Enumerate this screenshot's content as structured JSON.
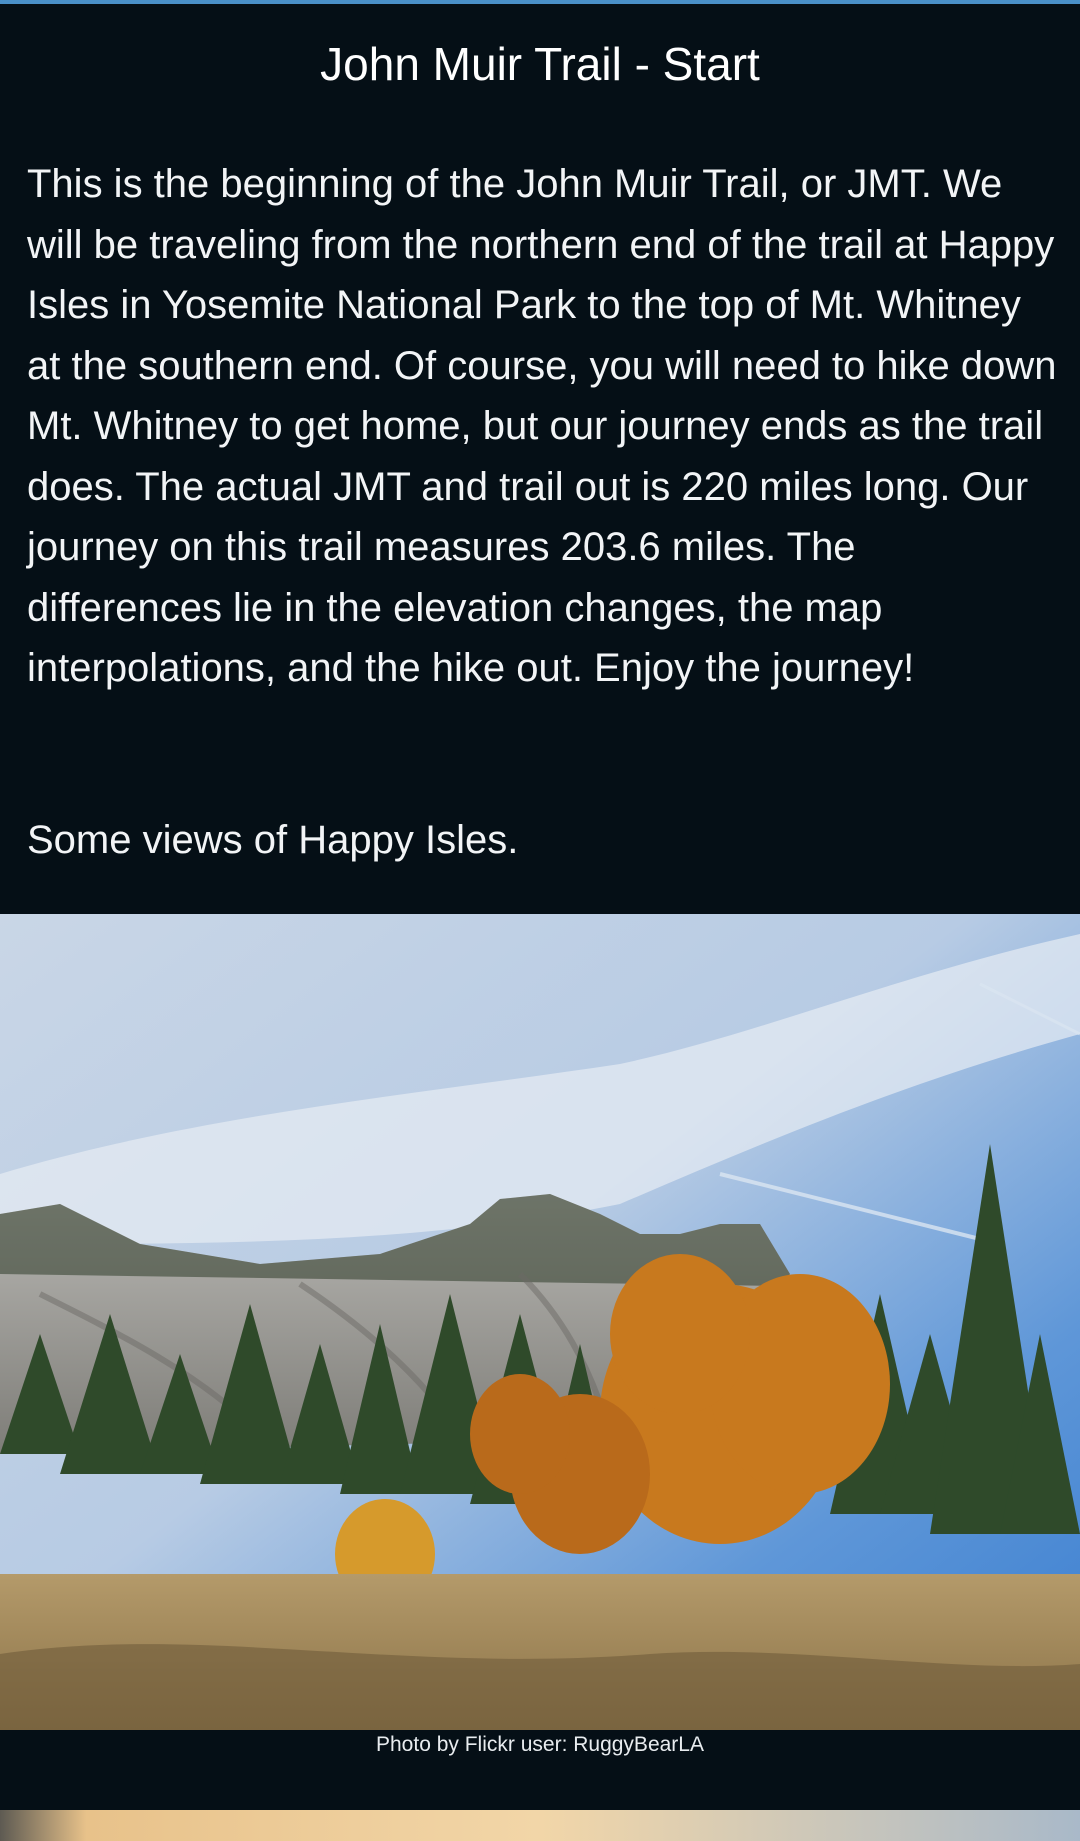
{
  "page": {
    "title": "John Muir Trail - Start",
    "intro": "This is the beginning of the John Muir Trail, or JMT. We will be traveling from the northern end of the trail at Happy Isles in Yosemite National Park to the top of Mt. Whitney at the southern end. Of course, you will need to hike down Mt. Whitney to get home, but our journey ends as the trail does. The actual JMT and trail out is 220 miles long. Our journey on this trail measures 203.6 miles. The differences lie in the elevation changes, the map interpolations, and the hike out. Enjoy the journey!",
    "views_heading": "Some views of Happy Isles."
  },
  "photos": [
    {
      "caption": "Photo by Flickr user: RuggyBearLA"
    }
  ],
  "colors": {
    "background": "#050f16",
    "accent": "#4a90c8",
    "text": "#ffffff"
  }
}
